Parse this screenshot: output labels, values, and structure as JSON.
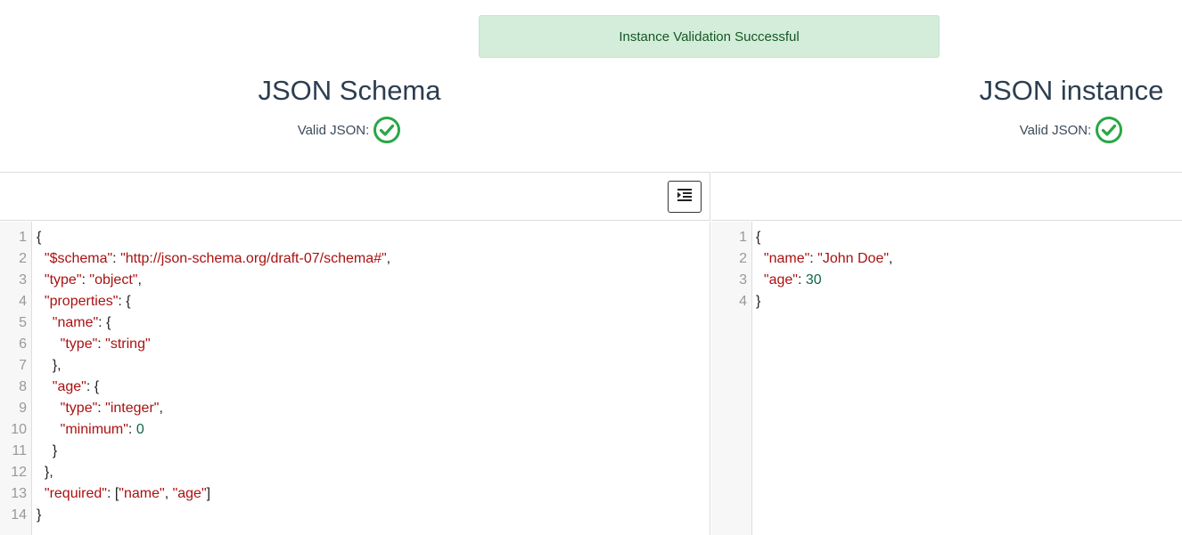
{
  "alert": {
    "text": "Instance Validation Successful"
  },
  "schema_panel": {
    "title": "JSON Schema",
    "valid_label": "Valid JSON:",
    "lines": [
      [
        [
          "p",
          "{"
        ]
      ],
      [
        [
          "p",
          "  "
        ],
        [
          "k",
          "\"$schema\""
        ],
        [
          "p",
          ": "
        ],
        [
          "s",
          "\"http://json-schema.org/draft-07/schema#\""
        ],
        [
          "p",
          ","
        ]
      ],
      [
        [
          "p",
          "  "
        ],
        [
          "k",
          "\"type\""
        ],
        [
          "p",
          ": "
        ],
        [
          "s",
          "\"object\""
        ],
        [
          "p",
          ","
        ]
      ],
      [
        [
          "p",
          "  "
        ],
        [
          "k",
          "\"properties\""
        ],
        [
          "p",
          ": {"
        ]
      ],
      [
        [
          "p",
          "    "
        ],
        [
          "k",
          "\"name\""
        ],
        [
          "p",
          ": {"
        ]
      ],
      [
        [
          "p",
          "      "
        ],
        [
          "k",
          "\"type\""
        ],
        [
          "p",
          ": "
        ],
        [
          "s",
          "\"string\""
        ]
      ],
      [
        [
          "p",
          "    },"
        ]
      ],
      [
        [
          "p",
          "    "
        ],
        [
          "k",
          "\"age\""
        ],
        [
          "p",
          ": {"
        ]
      ],
      [
        [
          "p",
          "      "
        ],
        [
          "k",
          "\"type\""
        ],
        [
          "p",
          ": "
        ],
        [
          "s",
          "\"integer\""
        ],
        [
          "p",
          ","
        ]
      ],
      [
        [
          "p",
          "      "
        ],
        [
          "k",
          "\"minimum\""
        ],
        [
          "p",
          ": "
        ],
        [
          "n",
          "0"
        ]
      ],
      [
        [
          "p",
          "    }"
        ]
      ],
      [
        [
          "p",
          "  },"
        ]
      ],
      [
        [
          "p",
          "  "
        ],
        [
          "k",
          "\"required\""
        ],
        [
          "p",
          ": ["
        ],
        [
          "s",
          "\"name\""
        ],
        [
          "p",
          ", "
        ],
        [
          "s",
          "\"age\""
        ],
        [
          "p",
          "]"
        ]
      ],
      [
        [
          "p",
          "}"
        ]
      ]
    ]
  },
  "instance_panel": {
    "title": "JSON instance",
    "valid_label": "Valid JSON:",
    "lines": [
      [
        [
          "p",
          "{"
        ]
      ],
      [
        [
          "p",
          "  "
        ],
        [
          "k",
          "\"name\""
        ],
        [
          "p",
          ": "
        ],
        [
          "s",
          "\"John Doe\""
        ],
        [
          "p",
          ","
        ]
      ],
      [
        [
          "p",
          "  "
        ],
        [
          "k",
          "\"age\""
        ],
        [
          "p",
          ": "
        ],
        [
          "n",
          "30"
        ]
      ],
      [
        [
          "p",
          "}"
        ]
      ]
    ]
  },
  "icons": {
    "valid": "check-circle-icon",
    "format": "indent-icon"
  },
  "colors": {
    "alert_bg": "#d4edda",
    "alert_text": "#155724",
    "check": "#28a745",
    "key": "#aa1111",
    "number": "#116644"
  }
}
